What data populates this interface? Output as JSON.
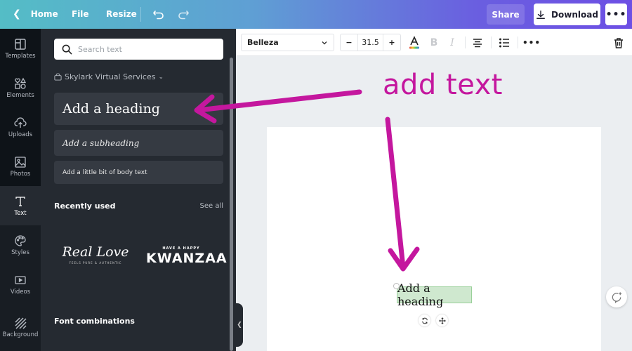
{
  "topbar": {
    "home_label": "Home",
    "file_label": "File",
    "resize_label": "Resize",
    "share_label": "Share",
    "download_label": "Download",
    "more_label": "•••"
  },
  "rail": {
    "items": [
      {
        "label": "Templates",
        "icon": "templates-icon"
      },
      {
        "label": "Elements",
        "icon": "elements-icon"
      },
      {
        "label": "Uploads",
        "icon": "uploads-icon"
      },
      {
        "label": "Photos",
        "icon": "photos-icon"
      },
      {
        "label": "Text",
        "icon": "text-icon",
        "active": true
      },
      {
        "label": "Styles",
        "icon": "styles-icon"
      },
      {
        "label": "Videos",
        "icon": "videos-icon"
      },
      {
        "label": "Background",
        "icon": "background-icon"
      }
    ]
  },
  "panel": {
    "search_placeholder": "Search text",
    "brand_kit": "Skylark Virtual Services",
    "add_heading": "Add a heading",
    "add_subheading": "Add a subheading",
    "add_body": "Add a little bit of body text",
    "recently_used_title": "Recently used",
    "see_all": "See all",
    "recent": [
      {
        "main": "Real Love",
        "sub": "FEELS PURE & AUTHENTIC"
      },
      {
        "main": "KWANZAA",
        "sub": "HAVE A HAPPY"
      }
    ],
    "font_combinations_title": "Font combinations"
  },
  "toolbar": {
    "font_name": "Belleza",
    "font_size": "31.5",
    "minus": "−",
    "plus": "+",
    "more": "•••"
  },
  "canvas": {
    "selected_text": "Add a heading"
  },
  "annotation": {
    "label": "add text",
    "color": "#c4179e"
  }
}
